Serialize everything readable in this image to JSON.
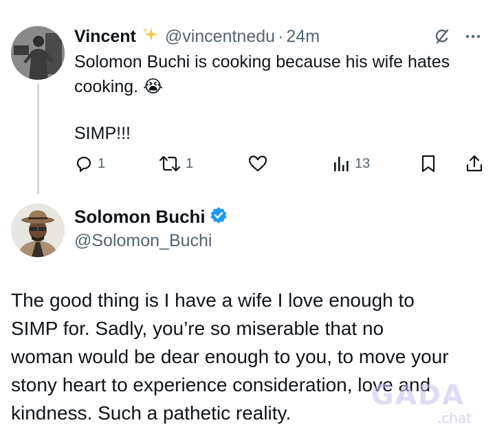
{
  "tweet1": {
    "display_name": "Vincent",
    "handle": "@vincentnedu",
    "separator": "·",
    "time": "24m",
    "text_lines": [
      "Solomon Buchi is cooking because his wife hates",
      "cooking. 😭"
    ],
    "text_extra": "SIMP!!!",
    "actions": {
      "reply_count": "1",
      "retweet_count": "1",
      "views_count": "13"
    },
    "icons": [
      "sparkle-icon",
      "grok-icon",
      "more-icon",
      "reply-icon",
      "retweet-icon",
      "like-icon",
      "views-icon",
      "bookmark-icon",
      "share-icon"
    ]
  },
  "tweet2": {
    "display_name": "Solomon Buchi",
    "handle": "@Solomon_Buchi",
    "verified_color": "#1d9bf0",
    "text_lines": [
      "The good thing is I have a wife I love enough to",
      "SIMP for. Sadly, you’re so miserable that no",
      "woman would be dear enough to you, to move your",
      "stony heart to experience consideration, love and",
      "kindness. Such a pathetic reality."
    ]
  },
  "watermark": {
    "main": "GADA",
    "sub": ".chat"
  },
  "colors": {
    "text": "#0f1419",
    "secondary": "#536471",
    "thread_line": "#cfd9de",
    "verified": "#1d9bf0"
  }
}
